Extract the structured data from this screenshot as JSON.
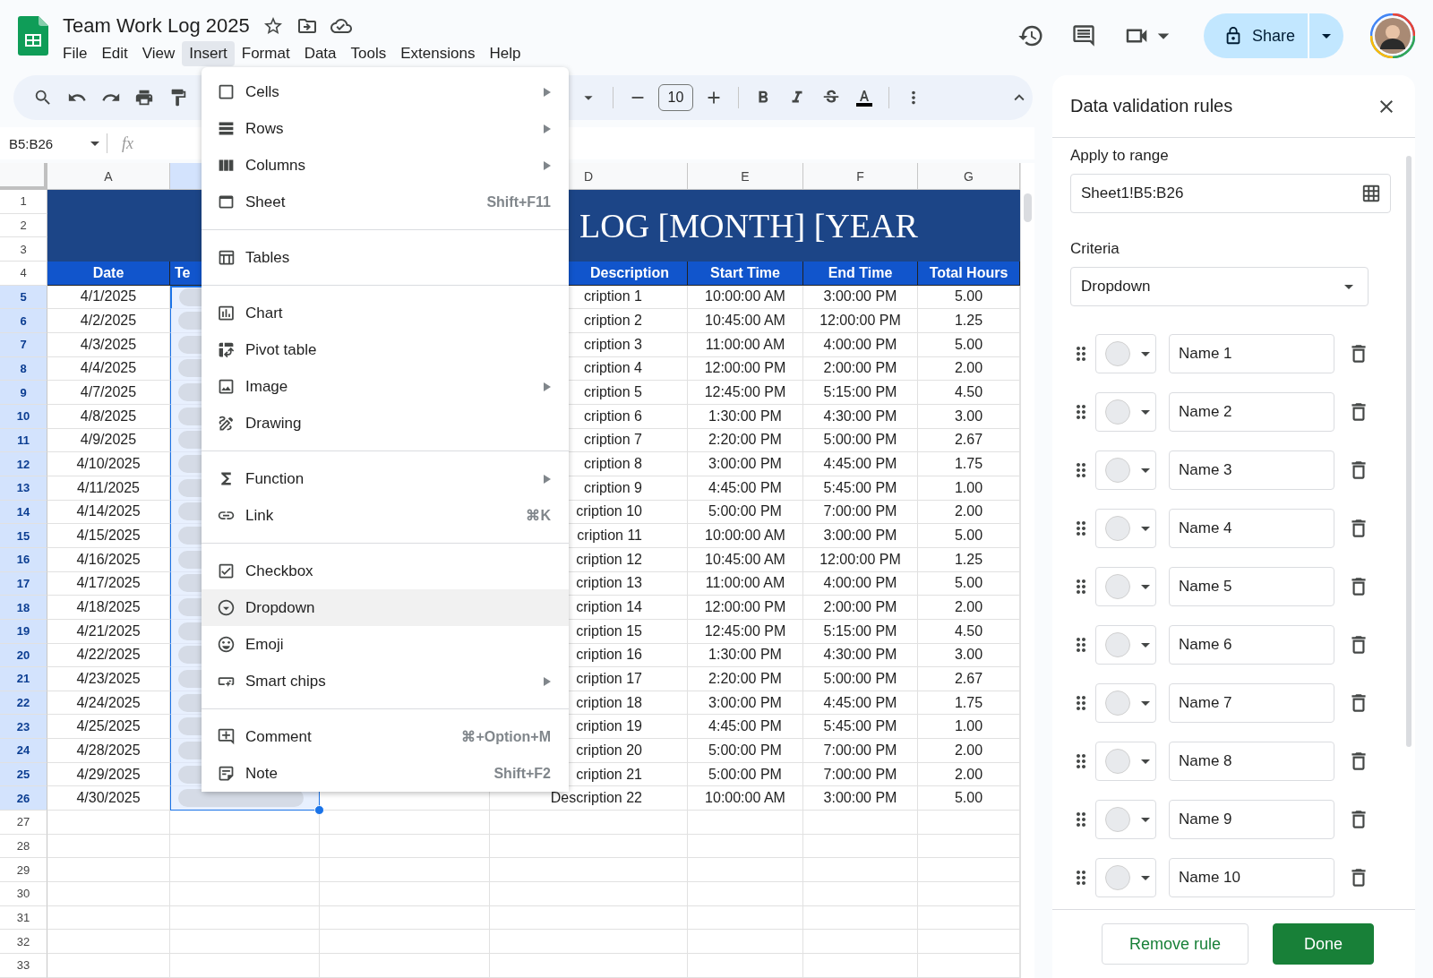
{
  "document": {
    "title": "Team Work Log 2025"
  },
  "menu_bar": [
    {
      "label": "File",
      "selected": false
    },
    {
      "label": "Edit",
      "selected": false
    },
    {
      "label": "View",
      "selected": false
    },
    {
      "label": "Insert",
      "selected": true
    },
    {
      "label": "Format",
      "selected": false
    },
    {
      "label": "Data",
      "selected": false
    },
    {
      "label": "Tools",
      "selected": false
    },
    {
      "label": "Extensions",
      "selected": false
    },
    {
      "label": "Help",
      "selected": false
    }
  ],
  "share_button": {
    "label": "Share"
  },
  "toolbar": {
    "font_size": "10"
  },
  "formula_bar": {
    "name_box": "B5:B26",
    "icon_text": "fx"
  },
  "sheet": {
    "column_headers": [
      {
        "label": "A",
        "selected": false
      },
      {
        "selected": true
      },
      {
        "label": "D",
        "selected": false
      },
      {
        "label": "E",
        "selected": false
      },
      {
        "label": "F",
        "selected": false
      },
      {
        "label": "G",
        "selected": false
      }
    ],
    "row_numbers": [
      {
        "label": "1",
        "selected": false
      },
      {
        "label": "2",
        "selected": false
      },
      {
        "label": "3",
        "selected": false
      },
      {
        "label": "4",
        "selected": false
      },
      {
        "label": "5",
        "selected": true
      },
      {
        "label": "6",
        "selected": true
      },
      {
        "label": "7",
        "selected": true
      },
      {
        "label": "8",
        "selected": true
      },
      {
        "label": "9",
        "selected": true
      },
      {
        "label": "10",
        "selected": true
      },
      {
        "label": "11",
        "selected": true
      },
      {
        "label": "12",
        "selected": true
      },
      {
        "label": "13",
        "selected": true
      },
      {
        "label": "14",
        "selected": true
      },
      {
        "label": "15",
        "selected": true
      },
      {
        "label": "16",
        "selected": true
      },
      {
        "label": "17",
        "selected": true
      },
      {
        "label": "18",
        "selected": true
      },
      {
        "label": "19",
        "selected": true
      },
      {
        "label": "20",
        "selected": true
      },
      {
        "label": "21",
        "selected": true
      },
      {
        "label": "22",
        "selected": true
      },
      {
        "label": "23",
        "selected": true
      },
      {
        "label": "24",
        "selected": true
      },
      {
        "label": "25",
        "selected": true
      },
      {
        "label": "26",
        "selected": true
      },
      {
        "label": "27",
        "selected": false
      },
      {
        "label": "28",
        "selected": false
      },
      {
        "label": "29",
        "selected": false
      },
      {
        "label": "30",
        "selected": false
      },
      {
        "label": "31",
        "selected": false
      },
      {
        "label": "32",
        "selected": false
      },
      {
        "label": "33",
        "selected": false
      }
    ],
    "banner": "LOG [MONTH] [YEAR",
    "header_cells": [
      "Date",
      "Te",
      "Description",
      "Start Time",
      "End Time",
      "Total Hours"
    ],
    "rows": [
      {
        "date": "4/1/2025",
        "description": "cription 1",
        "start": "10:00:00 AM",
        "end": "3:00:00 PM",
        "total": "5.00"
      },
      {
        "date": "4/2/2025",
        "description": "cription 2",
        "start": "10:45:00 AM",
        "end": "12:00:00 PM",
        "total": "1.25"
      },
      {
        "date": "4/3/2025",
        "description": "cription 3",
        "start": "11:00:00 AM",
        "end": "4:00:00 PM",
        "total": "5.00"
      },
      {
        "date": "4/4/2025",
        "description": "cription 4",
        "start": "12:00:00 PM",
        "end": "2:00:00 PM",
        "total": "2.00"
      },
      {
        "date": "4/7/2025",
        "description": "cription 5",
        "start": "12:45:00 PM",
        "end": "5:15:00 PM",
        "total": "4.50"
      },
      {
        "date": "4/8/2025",
        "description": "cription 6",
        "start": "1:30:00 PM",
        "end": "4:30:00 PM",
        "total": "3.00"
      },
      {
        "date": "4/9/2025",
        "description": "cription 7",
        "start": "2:20:00 PM",
        "end": "5:00:00 PM",
        "total": "2.67"
      },
      {
        "date": "4/10/2025",
        "description": "cription 8",
        "start": "3:00:00 PM",
        "end": "4:45:00 PM",
        "total": "1.75"
      },
      {
        "date": "4/11/2025",
        "description": "cription 9",
        "start": "4:45:00 PM",
        "end": "5:45:00 PM",
        "total": "1.00"
      },
      {
        "date": "4/14/2025",
        "description": "cription 10",
        "start": "5:00:00 PM",
        "end": "7:00:00 PM",
        "total": "2.00"
      },
      {
        "date": "4/15/2025",
        "description": "cription 11",
        "start": "10:00:00 AM",
        "end": "3:00:00 PM",
        "total": "5.00"
      },
      {
        "date": "4/16/2025",
        "description": "cription 12",
        "start": "10:45:00 AM",
        "end": "12:00:00 PM",
        "total": "1.25"
      },
      {
        "date": "4/17/2025",
        "description": "cription 13",
        "start": "11:00:00 AM",
        "end": "4:00:00 PM",
        "total": "5.00"
      },
      {
        "date": "4/18/2025",
        "description": "cription 14",
        "start": "12:00:00 PM",
        "end": "2:00:00 PM",
        "total": "2.00"
      },
      {
        "date": "4/21/2025",
        "description": "cription 15",
        "start": "12:45:00 PM",
        "end": "5:15:00 PM",
        "total": "4.50"
      },
      {
        "date": "4/22/2025",
        "description": "cription 16",
        "start": "1:30:00 PM",
        "end": "4:30:00 PM",
        "total": "3.00"
      },
      {
        "date": "4/23/2025",
        "description": "cription 17",
        "start": "2:20:00 PM",
        "end": "5:00:00 PM",
        "total": "2.67"
      },
      {
        "date": "4/24/2025",
        "description": "cription 18",
        "start": "3:00:00 PM",
        "end": "4:45:00 PM",
        "total": "1.75"
      },
      {
        "date": "4/25/2025",
        "description": "cription 19",
        "start": "4:45:00 PM",
        "end": "5:45:00 PM",
        "total": "1.00"
      },
      {
        "date": "4/28/2025",
        "description": "cription 20",
        "start": "5:00:00 PM",
        "end": "7:00:00 PM",
        "total": "2.00"
      },
      {
        "date": "4/29/2025",
        "description": "cription 21",
        "start": "5:00:00 PM",
        "end": "7:00:00 PM",
        "total": "2.00"
      },
      {
        "date": "4/30/2025",
        "description": "Description 22",
        "start": "10:00:00 AM",
        "end": "3:00:00 PM",
        "total": "5.00"
      }
    ]
  },
  "insert_menu": {
    "items": [
      {
        "kind": "item",
        "label": "Cells",
        "submenu": true,
        "highlighted": false
      },
      {
        "kind": "item",
        "label": "Rows",
        "submenu": true,
        "highlighted": false
      },
      {
        "kind": "item",
        "label": "Columns",
        "submenu": true,
        "highlighted": false
      },
      {
        "kind": "item",
        "label": "Sheet",
        "shortcut": "Shift+F11",
        "submenu": false,
        "highlighted": false
      },
      {
        "kind": "divider"
      },
      {
        "kind": "item",
        "label": "Tables",
        "submenu": false,
        "highlighted": false
      },
      {
        "kind": "divider"
      },
      {
        "kind": "item",
        "label": "Chart",
        "submenu": false,
        "highlighted": false
      },
      {
        "kind": "item",
        "label": "Pivot table",
        "submenu": false,
        "highlighted": false
      },
      {
        "kind": "item",
        "label": "Image",
        "submenu": true,
        "highlighted": false
      },
      {
        "kind": "item",
        "label": "Drawing",
        "submenu": false,
        "highlighted": false
      },
      {
        "kind": "divider"
      },
      {
        "kind": "item",
        "label": "Function",
        "submenu": true,
        "highlighted": false
      },
      {
        "kind": "item",
        "label": "Link",
        "shortcut": "⌘K",
        "submenu": false,
        "highlighted": false
      },
      {
        "kind": "divider"
      },
      {
        "kind": "item",
        "label": "Checkbox",
        "submenu": false,
        "highlighted": false
      },
      {
        "kind": "item",
        "label": "Dropdown",
        "submenu": false,
        "highlighted": true
      },
      {
        "kind": "item",
        "label": "Emoji",
        "submenu": false,
        "highlighted": false
      },
      {
        "kind": "item",
        "label": "Smart chips",
        "submenu": true,
        "highlighted": false
      },
      {
        "kind": "divider"
      },
      {
        "kind": "item",
        "label": "Comment",
        "shortcut": "⌘+Option+M",
        "submenu": false,
        "highlighted": false
      },
      {
        "kind": "item",
        "label": "Note",
        "shortcut": "Shift+F2",
        "submenu": false,
        "highlighted": false
      }
    ]
  },
  "panel": {
    "title": "Data validation rules",
    "range_label": "Apply to range",
    "range_value": "Sheet1!B5:B26",
    "criteria_label": "Criteria",
    "criteria_value": "Dropdown",
    "options": [
      {
        "value": "Name 1"
      },
      {
        "value": "Name 2"
      },
      {
        "value": "Name 3"
      },
      {
        "value": "Name 4"
      },
      {
        "value": "Name 5"
      },
      {
        "value": "Name 6"
      },
      {
        "value": "Name 7"
      },
      {
        "value": "Name 8"
      },
      {
        "value": "Name 9"
      },
      {
        "value": "Name 10"
      }
    ],
    "buttons": [
      {
        "label": "Remove rule",
        "kind": "secondary"
      },
      {
        "label": "Done",
        "kind": "primary"
      }
    ]
  }
}
